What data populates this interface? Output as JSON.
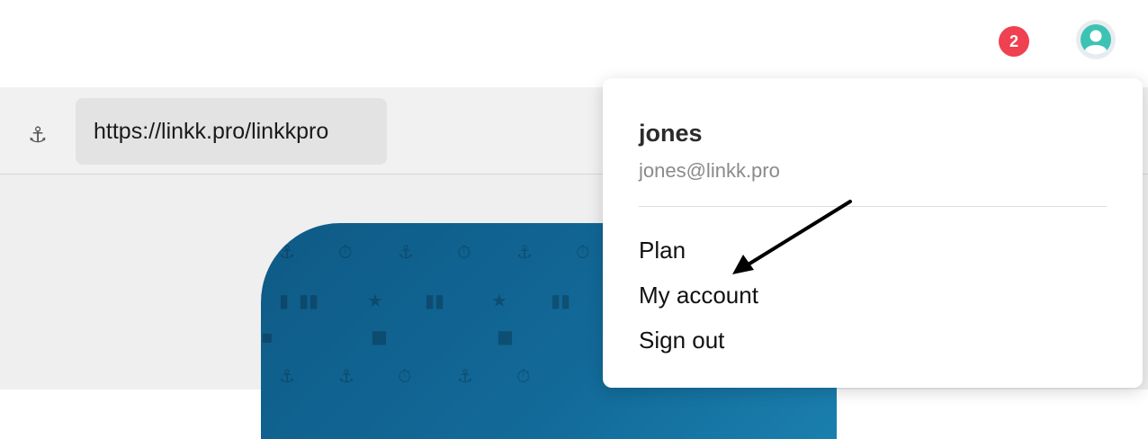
{
  "topbar": {
    "notification_count": "2",
    "avatar_icon": "user-avatar-icon"
  },
  "urlbar": {
    "anchor_icon": "⚓",
    "url": "https://linkk.pro/linkkpro"
  },
  "dropdown": {
    "user_name": "jones",
    "user_email": "jones@linkk.pro",
    "items": [
      {
        "label": "Plan"
      },
      {
        "label": "My account"
      },
      {
        "label": "Sign out"
      }
    ]
  },
  "colors": {
    "badge": "#ef4150",
    "avatar": "#3cc3b4",
    "card": "#126a99"
  }
}
